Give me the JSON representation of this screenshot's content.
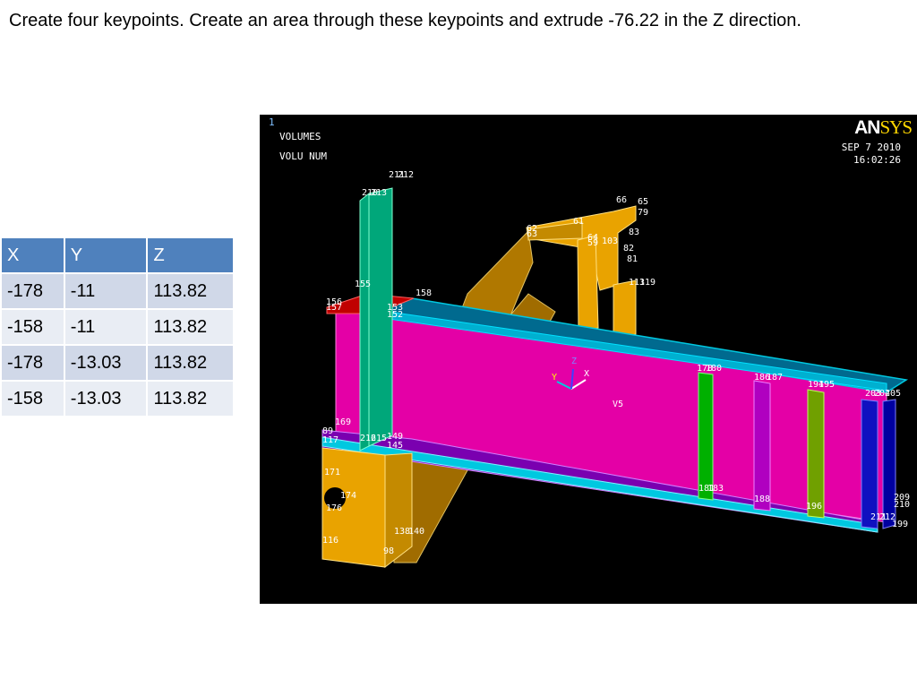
{
  "instruction": "Create four keypoints. Create an area through these keypoints and extrude -76.22 in the Z direction.",
  "table": {
    "headers": [
      "X",
      "Y",
      "Z"
    ],
    "rows": [
      [
        "-178",
        "-11",
        "113.82"
      ],
      [
        "-158",
        "-11",
        "113.82"
      ],
      [
        "-178",
        "-13.03",
        "113.82"
      ],
      [
        "-158",
        "-13.03",
        "113.82"
      ]
    ]
  },
  "viewport": {
    "window_number": "1",
    "label_line1": "VOLUMES",
    "label_line2": "VOLU NUM",
    "date": "SEP  7 2010",
    "time": "16:02:26",
    "logo_part1": "AN",
    "logo_part2": "SYS",
    "volume_label": "V5",
    "axis_y": "Y",
    "axis_x": "X",
    "axis_z": "Z",
    "keypoint_labels": [
      "211",
      "212",
      "210",
      "213",
      "66",
      "65",
      "79",
      "62",
      "63",
      "61",
      "64",
      "59",
      "103",
      "83",
      "82",
      "81",
      "155",
      "156",
      "157",
      "158",
      "153",
      "152",
      "113",
      "119",
      "178",
      "180",
      "186",
      "187",
      "194",
      "195",
      "203",
      "204",
      "205",
      "169",
      "89",
      "117",
      "216",
      "215",
      "149",
      "145",
      "171",
      "174",
      "176",
      "116",
      "181",
      "183",
      "188",
      "196",
      "138",
      "140",
      "98",
      "209",
      "210",
      "211",
      "212",
      "199"
    ]
  },
  "colors": {
    "web": "#e400a6",
    "flange_top": "#006a8f",
    "flange_edge": "#00c8e0",
    "gusset": "#b07800",
    "orange": "#e9a300",
    "green_plate": "#00a77a",
    "header_blue": "#4f81bd"
  }
}
